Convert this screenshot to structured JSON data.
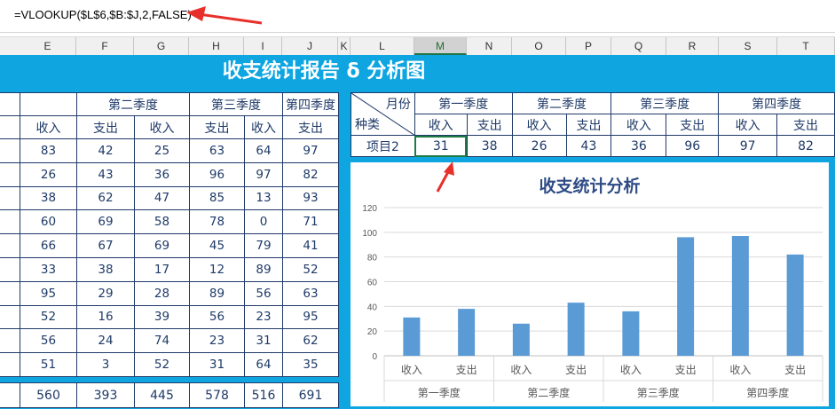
{
  "formula_bar": {
    "formula": "=VLOOKUP($L$6,$B:$J,2,FALSE)"
  },
  "column_headers": [
    "E",
    "F",
    "G",
    "H",
    "I",
    "J",
    "K",
    "L",
    "M",
    "N",
    "O",
    "P",
    "Q",
    "R",
    "S",
    "T"
  ],
  "selected_column": "M",
  "sheet_title": "收支统计报告 δ 分析图",
  "left_table": {
    "quarters": [
      "第二季度",
      "第三季度",
      "第四季度"
    ],
    "subheaders": [
      "收入",
      "支出",
      "收入",
      "支出",
      "收入",
      "支出"
    ],
    "rows": [
      [
        "83",
        "42",
        "25",
        "63",
        "64",
        "97"
      ],
      [
        "26",
        "43",
        "36",
        "96",
        "97",
        "82"
      ],
      [
        "38",
        "62",
        "47",
        "85",
        "13",
        "93"
      ],
      [
        "60",
        "69",
        "58",
        "78",
        "0",
        "71"
      ],
      [
        "66",
        "67",
        "69",
        "45",
        "79",
        "41"
      ],
      [
        "33",
        "38",
        "17",
        "12",
        "89",
        "52"
      ],
      [
        "95",
        "29",
        "28",
        "89",
        "56",
        "63"
      ],
      [
        "52",
        "16",
        "39",
        "56",
        "23",
        "95"
      ],
      [
        "56",
        "24",
        "74",
        "23",
        "31",
        "62"
      ],
      [
        "51",
        "3",
        "52",
        "31",
        "64",
        "35"
      ]
    ],
    "totals": [
      "560",
      "393",
      "445",
      "578",
      "516",
      "691"
    ]
  },
  "lookup_table": {
    "corner_top": "月份",
    "corner_bottom": "种类",
    "quarters": [
      "第一季度",
      "第二季度",
      "第三季度",
      "第四季度"
    ],
    "subheaders": [
      "收入",
      "支出",
      "收入",
      "支出",
      "收入",
      "支出",
      "收入",
      "支出"
    ],
    "row_label": "项目2",
    "values": [
      "31",
      "38",
      "26",
      "43",
      "36",
      "96",
      "97",
      "82"
    ]
  },
  "chart_data": {
    "type": "bar",
    "title": "收支统计分析",
    "categories": [
      "收入",
      "支出",
      "收入",
      "支出",
      "收入",
      "支出",
      "收入",
      "支出"
    ],
    "groups": [
      "第一季度",
      "第二季度",
      "第三季度",
      "第四季度"
    ],
    "values": [
      31,
      38,
      26,
      43,
      36,
      96,
      97,
      82
    ],
    "ylim": [
      0,
      120
    ],
    "yticks": [
      0,
      20,
      40,
      60,
      80,
      100,
      120
    ],
    "grid": true,
    "bar_color": "#5b9bd5"
  },
  "colors": {
    "sheet_bg": "#0ea5e0",
    "table_text": "#1f3a68",
    "selection": "#217346",
    "annotation_arrow": "#e8302a"
  }
}
